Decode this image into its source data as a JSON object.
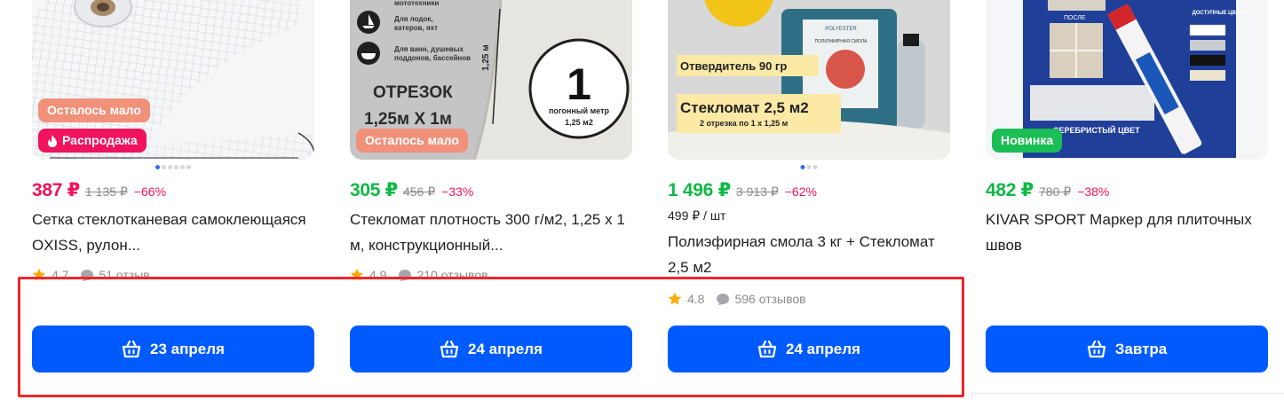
{
  "products": [
    {
      "badges": [
        "Осталось мало",
        "Распродажа"
      ],
      "price": "387 ₽",
      "old_price": "1 135 ₽",
      "discount": "−66%",
      "title": "Сетка стеклотканевая самоклеющаяся OXISS, рулон...",
      "rating": "4.7",
      "reviews": "51 отзыв",
      "delivery": "23 апреля"
    },
    {
      "badges": [
        "Осталось мало"
      ],
      "image_text": {
        "line1": "Для лодок, катеров, яхт",
        "line2": "Для ванн, душевых поддонов, бассейнов",
        "top": "мототехники",
        "cut": "ОТРЕЗОК",
        "size": "1,25м Х 1м",
        "height": "1,25 м",
        "circle_num": "1",
        "circle_l1": "погонный метр",
        "circle_l2": "1,25 м2"
      },
      "price": "305 ₽",
      "old_price": "456 ₽",
      "discount": "−33%",
      "title": "Стекломат плотность 300 г/м2, 1,25 х 1 м, конструкционный...",
      "rating": "4.9",
      "reviews": "210 отзывов",
      "delivery": "24 апреля"
    },
    {
      "badges": [],
      "image_text": {
        "hardener": "Отвердитель 90 гр",
        "mat": "Стекломат 2,5 м2",
        "mat_sub": "2 отрезка по 1 х 1,25 м",
        "jar_brand": "POLYESTER",
        "jar_label": "ПОЛИЭФИРНАЯ СМОЛА"
      },
      "price": "1 496 ₽",
      "old_price": "3 913 ₽",
      "discount": "−62%",
      "unit_price": "499 ₽ / шт",
      "title": "Полиэфирная смола 3 кг + Стекломат 2,5 м2",
      "rating": "4.8",
      "reviews": "596 отзывов",
      "delivery": "24 апреля"
    },
    {
      "badges": [
        "Новинка"
      ],
      "image_text": {
        "after": "ПОСЛЕ",
        "colors_title": "ДОСТУПНЫЕ ЦВЕТА:",
        "silver": "СЕРЕБРИСТЫЙ ЦВЕТ"
      },
      "price": "482 ₽",
      "old_price": "780 ₽",
      "discount": "−38%",
      "title": "KIVAR SPORT Маркер для плиточных швов",
      "delivery": "Завтра"
    }
  ],
  "colors": {
    "accent": "#005bff",
    "price_red": "#f1135a",
    "price_green": "#10b845",
    "highlight": "#f0262c"
  }
}
